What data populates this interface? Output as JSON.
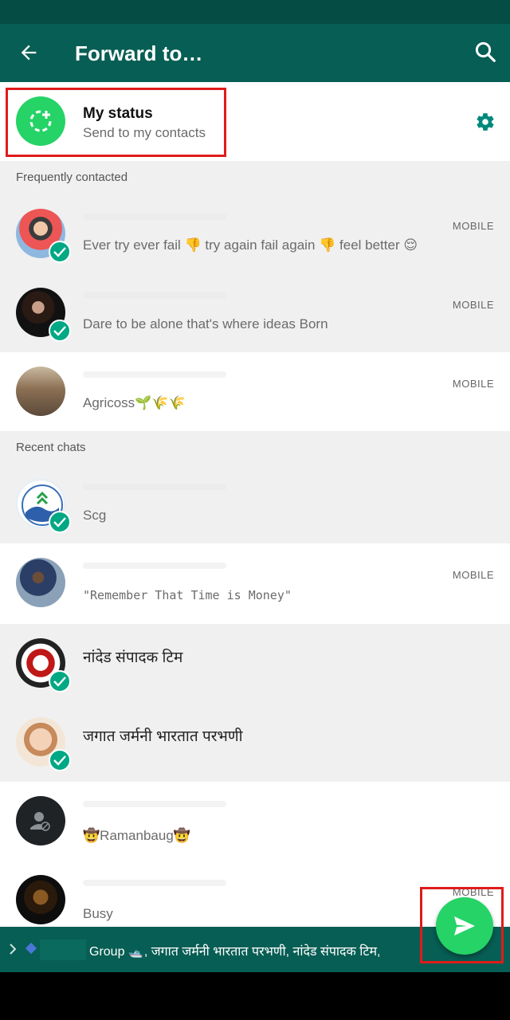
{
  "appbar": {
    "title": "Forward to…",
    "back_icon": "arrow-left-icon",
    "search_icon": "search-icon"
  },
  "my_status": {
    "name": "My status",
    "subtitle": "Send to my contacts",
    "settings_icon": "gear-icon"
  },
  "sections": {
    "frequent": "Frequently contacted",
    "recent": "Recent chats"
  },
  "frequent_contacts": [
    {
      "status": "Ever try ever fail 👎 try again fail again 👎 feel better 😌",
      "type": "MOBILE",
      "selected": true
    },
    {
      "status": "Dare to be alone that's where ideas Born",
      "type": "MOBILE",
      "selected": true
    },
    {
      "status": "Agricoss🌱🌾🌾",
      "type": "MOBILE",
      "selected": false
    }
  ],
  "recent_chats": [
    {
      "name": "",
      "status": "Scg",
      "type": "",
      "selected": true
    },
    {
      "name": "",
      "status": "\"Remember That Time is Money\"",
      "type": "MOBILE",
      "selected": false
    },
    {
      "name": "नांदेड संपादक टिम",
      "status": "",
      "type": "",
      "selected": true
    },
    {
      "name": "जगात जर्मनी भारतात परभणी",
      "status": "",
      "type": "",
      "selected": true
    },
    {
      "name": "",
      "status": "🤠Ramanbaug🤠",
      "type": "",
      "selected": false
    },
    {
      "name": "",
      "status": "Busy",
      "type": "MOBILE",
      "selected": false
    }
  ],
  "selection_bar": {
    "names": "Group 🛥️, जगात जर्मनी भारतात परभणी, नांदेड संपादक टिम,"
  },
  "fab": {
    "icon": "send-icon"
  },
  "colors": {
    "header": "#075e54",
    "accent": "#25d366",
    "check": "#00a884",
    "highlight": "#e01b1b"
  }
}
